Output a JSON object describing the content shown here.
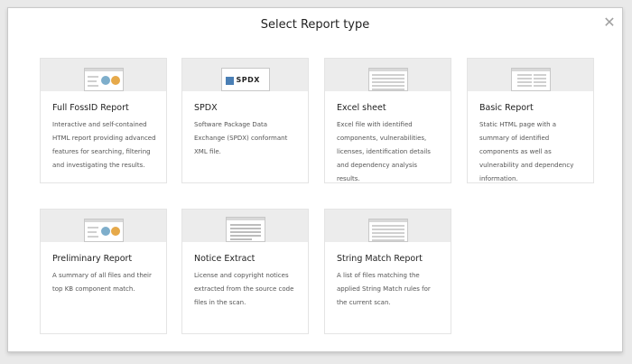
{
  "dialog": {
    "title": "Select Report type",
    "close_icon": "close-icon"
  },
  "reports": [
    {
      "title": "Full FossID Report",
      "desc": "Interactive and self-contained HTML report providing advanced features for searching, filtering and investigating the results.",
      "icon": "fossid-report-thumbnail"
    },
    {
      "title": "SPDX",
      "desc": "Software Package Data Exchange (SPDX) conformant XML file.",
      "icon": "spdx-logo",
      "logo_text": "SPDX"
    },
    {
      "title": "Excel sheet",
      "desc": "Excel file with identified components, vulnerabilities, licenses, identification details and dependency analysis results.",
      "icon": "spreadsheet-thumbnail"
    },
    {
      "title": "Basic Report",
      "desc": "Static HTML page with a summary of identified components as well as vulnerability and dependency information.",
      "icon": "basic-report-thumbnail"
    },
    {
      "title": "Preliminary Report",
      "desc": "A summary of all files and their top KB component match.",
      "icon": "preliminary-report-thumbnail"
    },
    {
      "title": "Notice Extract",
      "desc": "License and copyright notices extracted from the source code files in the scan.",
      "icon": "notice-thumbnail"
    },
    {
      "title": "String Match Report",
      "desc": "A list of files matching the applied String Match rules for the current scan.",
      "icon": "string-match-thumbnail"
    }
  ],
  "colors": {
    "dot_blue": "#7eaecb",
    "dot_orange": "#e6a94a",
    "spdx_blue": "#4a7fb5"
  }
}
